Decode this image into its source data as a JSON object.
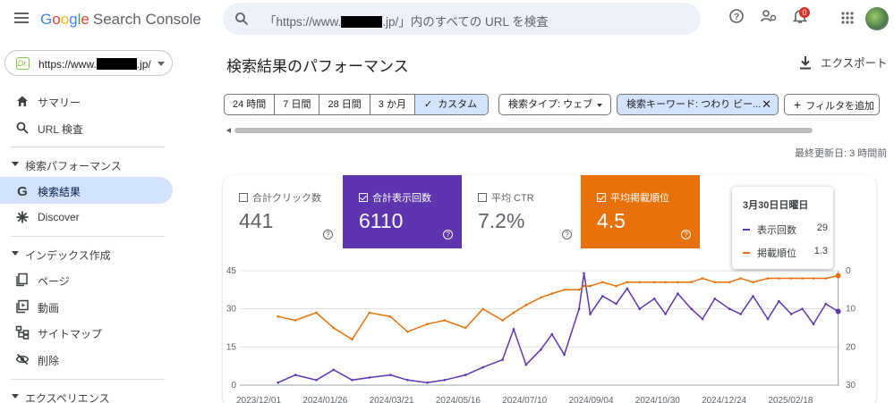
{
  "app": {
    "logo_google": [
      "G",
      "o",
      "o",
      "g",
      "l",
      "e"
    ],
    "logo_suffix": "Search Console"
  },
  "search": {
    "placeholder_prefix": "「https://www.",
    "placeholder_suffix": ".jp/」内のすべての URL を検査"
  },
  "header": {
    "notification_count": "0"
  },
  "property": {
    "favicon_text": "Dr.",
    "url_prefix": "https://www.",
    "url_suffix": ".jp/"
  },
  "sidebar": {
    "summary": "サマリー",
    "url_inspection": "URL 検査",
    "section_performance": "検索パフォーマンス",
    "search_results": "検索結果",
    "discover": "Discover",
    "section_index": "インデックス作成",
    "pages": "ページ",
    "videos": "動画",
    "sitemaps": "サイトマップ",
    "removals": "削除",
    "section_experience": "エクスペリエンス"
  },
  "main": {
    "title": "検索結果のパフォーマンス",
    "export_label": "エクスポート",
    "date_ranges": [
      "24 時間",
      "7 日間",
      "28 日間",
      "3 か月",
      "カスタム"
    ],
    "selected_range_index": 4,
    "filter_search_type": "検索タイプ: ウェブ",
    "filter_query": "検索キーワード: つわり ビー...",
    "add_filter": "フィルタを追加",
    "last_updated": "最終更新日: 3 時間前"
  },
  "metrics": [
    {
      "label": "合計クリック数",
      "value": "441",
      "checked": false
    },
    {
      "label": "合計表示回数",
      "value": "6110",
      "checked": true,
      "color": "#5e35b1"
    },
    {
      "label": "平均 CTR",
      "value": "7.2%",
      "checked": false
    },
    {
      "label": "平均掲載順位",
      "value": "4.5",
      "checked": true,
      "color": "#e8710a"
    }
  ],
  "tooltip": {
    "date": "3月30日日曜日",
    "rows": [
      {
        "label": "表示回数",
        "value": "29",
        "color": "#5e35b1"
      },
      {
        "label": "掲載順位",
        "value": "1.3",
        "color": "#e8710a"
      }
    ]
  },
  "chart_data": {
    "type": "line",
    "x_tick_labels": [
      "2023/12/01",
      "2024/01/26",
      "2024/03/21",
      "2024/05/16",
      "2024/07/10",
      "2024/09/04",
      "2024/10/30",
      "2024/12/24",
      "2025/02/18"
    ],
    "x_range": [
      "2023-12-01",
      "2025-03-31"
    ],
    "y_left": {
      "ticks": [
        "0",
        "15",
        "30",
        "45"
      ],
      "range": [
        0,
        45
      ]
    },
    "y_right": {
      "ticks": [
        "0",
        "10",
        "20",
        "30"
      ],
      "range": [
        30,
        0
      ],
      "reversed": true
    },
    "grid": true,
    "series": [
      {
        "name": "表示回数",
        "axis": "left",
        "color": "#5e35b1",
        "x": [
          "2024-01-01",
          "2024-01-15",
          "2024-02-01",
          "2024-02-15",
          "2024-03-01",
          "2024-03-15",
          "2024-04-01",
          "2024-04-15",
          "2024-05-01",
          "2024-05-15",
          "2024-06-01",
          "2024-06-15",
          "2024-07-01",
          "2024-07-10",
          "2024-07-20",
          "2024-08-01",
          "2024-08-10",
          "2024-08-20",
          "2024-09-01",
          "2024-09-05",
          "2024-09-10",
          "2024-09-20",
          "2024-10-01",
          "2024-10-10",
          "2024-10-20",
          "2024-11-01",
          "2024-11-10",
          "2024-11-20",
          "2024-12-01",
          "2024-12-10",
          "2024-12-20",
          "2025-01-01",
          "2025-01-10",
          "2025-01-20",
          "2025-02-01",
          "2025-02-10",
          "2025-02-20",
          "2025-03-01",
          "2025-03-10",
          "2025-03-20",
          "2025-03-30"
        ],
        "values": [
          1,
          4,
          2,
          6,
          2,
          3,
          4,
          2,
          1,
          2,
          4,
          7,
          10,
          22,
          8,
          14,
          20,
          12,
          30,
          44,
          28,
          35,
          32,
          38,
          30,
          34,
          28,
          36,
          30,
          26,
          34,
          30,
          28,
          35,
          26,
          33,
          28,
          30,
          24,
          32,
          29
        ]
      },
      {
        "name": "掲載順位",
        "axis": "right",
        "color": "#e8710a",
        "x": [
          "2024-01-01",
          "2024-01-15",
          "2024-02-01",
          "2024-02-15",
          "2024-03-01",
          "2024-03-15",
          "2024-04-01",
          "2024-04-15",
          "2024-05-01",
          "2024-05-15",
          "2024-06-01",
          "2024-06-15",
          "2024-07-01",
          "2024-07-10",
          "2024-07-20",
          "2024-08-01",
          "2024-08-10",
          "2024-08-20",
          "2024-09-01",
          "2024-09-05",
          "2024-09-10",
          "2024-09-20",
          "2024-10-01",
          "2024-10-10",
          "2024-10-20",
          "2024-11-01",
          "2024-11-10",
          "2024-11-20",
          "2024-12-01",
          "2024-12-10",
          "2024-12-20",
          "2025-01-01",
          "2025-01-10",
          "2025-01-20",
          "2025-02-01",
          "2025-02-10",
          "2025-02-20",
          "2025-03-01",
          "2025-03-10",
          "2025-03-20",
          "2025-03-30"
        ],
        "values": [
          12,
          13,
          11,
          15,
          18,
          11,
          12,
          16,
          14,
          13,
          15,
          10,
          13,
          11,
          9,
          7,
          6,
          5,
          5,
          4,
          4,
          3,
          4,
          3,
          3,
          3,
          3,
          3,
          3,
          2,
          3,
          3,
          2,
          3,
          2,
          2,
          2,
          2,
          2,
          2,
          1.3
        ]
      }
    ]
  }
}
